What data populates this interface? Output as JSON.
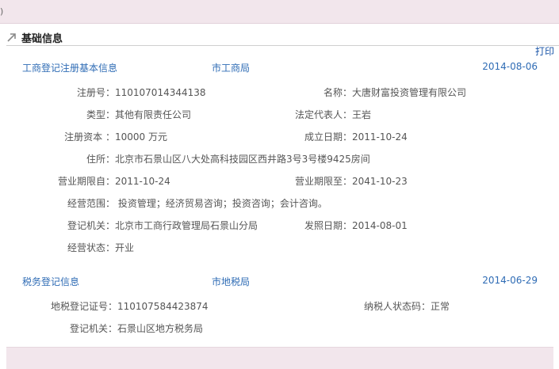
{
  "topbar": {
    "stub": ")"
  },
  "section": {
    "title": "基础信息"
  },
  "print_label": "打印",
  "business": {
    "title": "工商登记注册基本信息",
    "org": "市工商局",
    "date": "2014-08-06",
    "reg_no_label": "注册号：",
    "reg_no": "110107014344138",
    "name_label": "名称：",
    "name": "大唐财富投资管理有限公司",
    "type_label": "类型：",
    "type": "其他有限责任公司",
    "legal_label": "法定代表人：",
    "legal": "王岩",
    "capital_label": "注册资本 ：",
    "capital": "10000 万元",
    "founded_label": "成立日期：",
    "founded": "2011-10-24",
    "address_label": "住所：",
    "address": "北京市石景山区八大处高科技园区西井路3号3号楼9425房间",
    "term_from_label": "营业期限自：",
    "term_from": "2011-10-24",
    "term_to_label": "营业期限至：",
    "term_to": "2041-10-23",
    "scope_label": "经营范围：",
    "scope": "投资管理；经济贸易咨询；投资咨询；会计咨询。",
    "authority_label": "登记机关：",
    "authority": "北京市工商行政管理局石景山分局",
    "issue_label": "发照日期：",
    "issue": "2014-08-01",
    "status_label": "经营状态：",
    "status": "开业"
  },
  "tax": {
    "title": "税务登记信息",
    "org": "市地税局",
    "date": "2014-06-29",
    "cert_label": "地税登记证号：",
    "cert": "110107584423874",
    "taxpayer_label": "纳税人状态码：",
    "taxpayer": "正常",
    "authority_label": "登记机关：",
    "authority": "石景山区地方税务局"
  }
}
